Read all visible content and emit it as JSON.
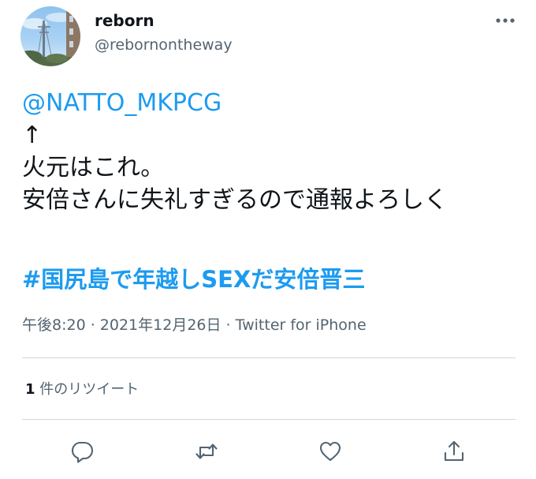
{
  "tweet": {
    "author": {
      "display_name": "reborn",
      "handle": "@rebornontheway"
    },
    "lines": {
      "mention": "@NATTO_MKPCG",
      "arrow": "↑",
      "line1": "火元はこれ。",
      "line2": "安倍さんに失礼すぎるので通報よろしく"
    },
    "hashtag": "#国尻島で年越しSEXだ安倍晋三",
    "meta": {
      "time": "午後8:20",
      "separator": " · ",
      "date": "2021年12月26日",
      "source": "Twitter for iPhone"
    },
    "stats": {
      "retweet_count": "1",
      "retweet_label": " 件のリツイート"
    }
  },
  "icons": {
    "more": "more-horizontal-icon",
    "reply": "reply-icon",
    "retweet": "retweet-icon",
    "like": "like-icon",
    "share": "share-icon"
  },
  "colors": {
    "link": "#1d9bf0",
    "secondary_text": "#536471",
    "divider": "#cfd9de"
  }
}
